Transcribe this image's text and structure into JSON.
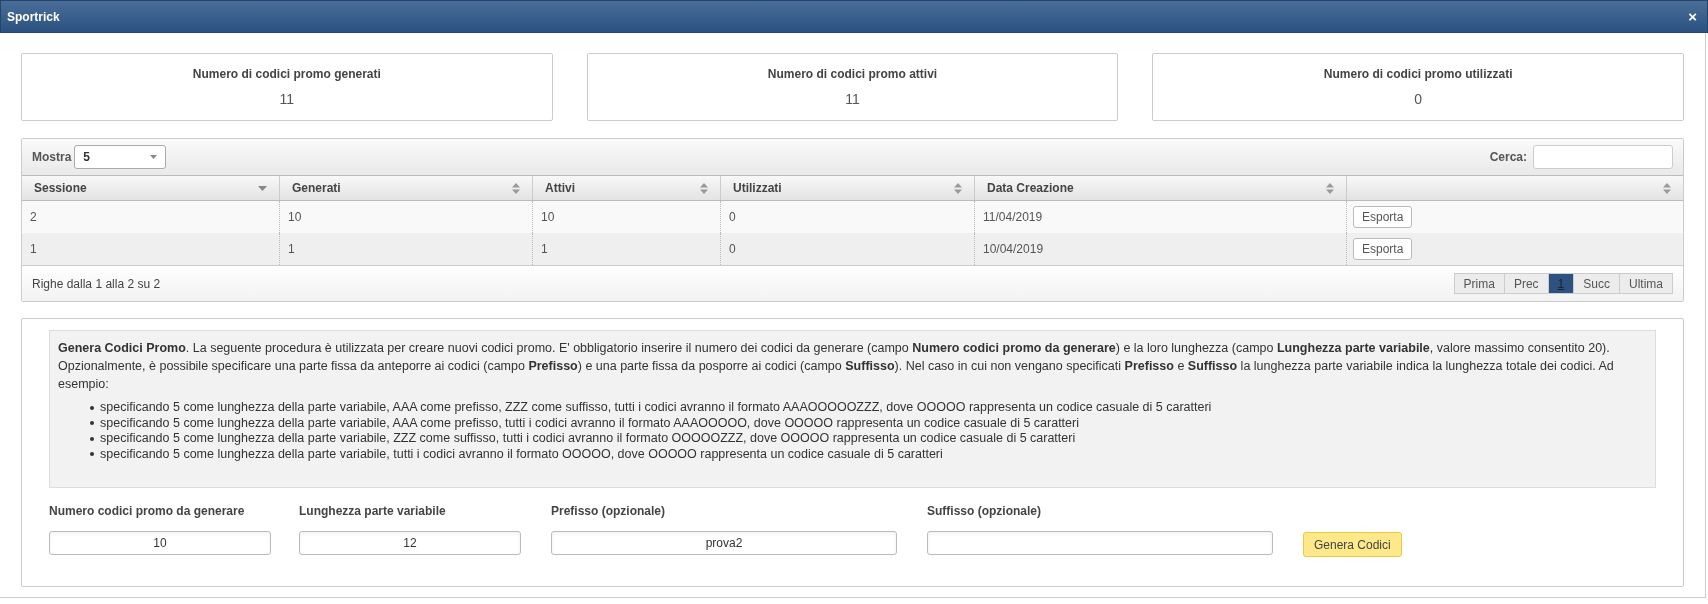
{
  "window": {
    "title": "Sportrick",
    "close": "×"
  },
  "stats": [
    {
      "label": "Numero di codici promo generati",
      "value": "11"
    },
    {
      "label": "Numero di codici promo attivi",
      "value": "11"
    },
    {
      "label": "Numero di codici promo utilizzati",
      "value": "0"
    }
  ],
  "table": {
    "length_label": "Mostra",
    "length_value": "5",
    "search_label": "Cerca:",
    "columns": [
      {
        "label": "Sessione",
        "sorted": true
      },
      {
        "label": "Generati",
        "sorted": false
      },
      {
        "label": "Attivi",
        "sorted": false
      },
      {
        "label": "Utilizzati",
        "sorted": false
      },
      {
        "label": "Data Creazione",
        "sorted": false
      },
      {
        "sorted": false
      }
    ],
    "rows": [
      {
        "cells": [
          "2",
          "10",
          "10",
          "0",
          "11/04/2019"
        ],
        "action": "Esporta"
      },
      {
        "cells": [
          "1",
          "1",
          "1",
          "0",
          "10/04/2019"
        ],
        "action": "Esporta"
      }
    ],
    "info": "Righe dalla 1 alla 2 su 2",
    "pagination": [
      {
        "label": "Prima",
        "selected": false
      },
      {
        "label": "Prec",
        "selected": false
      },
      {
        "label": "1",
        "selected": true
      },
      {
        "label": "Succ",
        "selected": false
      },
      {
        "label": "Ultima",
        "selected": false
      }
    ]
  },
  "generator": {
    "description": "**Genera Codici Promo**. La seguente procedura è utilizzata per creare nuovi codici promo. E' obbligatorio inserire il numero dei codici da generare (campo **Numero codici promo da generare**) e la loro lunghezza (campo **Lunghezza parte variabile**, valore massimo consentito 20). Opzionalmente, è possibile specificare una parte fissa da anteporre ai codici (campo **Prefisso**) e una parte fissa da posporre ai codici (campo **Suffisso**). Nel caso in cui non vengano specificati **Prefisso** e **Suffisso** la lunghezza parte variabile indica la lunghezza totale dei codici. Ad esempio:",
    "examples": [
      "specificando 5 come lunghezza della parte variabile, AAA come prefisso, ZZZ come suffisso, tutti i codici avranno il formato AAAOOOOOZZZ, dove OOOOO rappresenta un codice casuale di 5 caratteri",
      "specificando 5 come lunghezza della parte variabile, AAA come prefisso, tutti i codici avranno il formato AAAOOOOO, dove OOOOO rappresenta un codice casuale di 5 caratteri",
      "specificando 5 come lunghezza della parte variabile, ZZZ come suffisso, tutti i codici avranno il formato OOOOOZZZ, dove OOOOO rappresenta un codice casuale di 5 caratteri",
      "specificando 5 come lunghezza della parte variabile, tutti i codici avranno il formato OOOOO, dove OOOOO rappresenta un codice casuale di 5 caratteri"
    ],
    "fields": [
      {
        "label": "Numero codici promo da generare",
        "value": "10"
      },
      {
        "label": "Lunghezza parte variabile",
        "value": "12"
      },
      {
        "label": "Prefisso (opzionale)",
        "value": "prova2"
      },
      {
        "label": "Suffisso (opzionale)"
      }
    ],
    "button": "Genera Codici"
  }
}
